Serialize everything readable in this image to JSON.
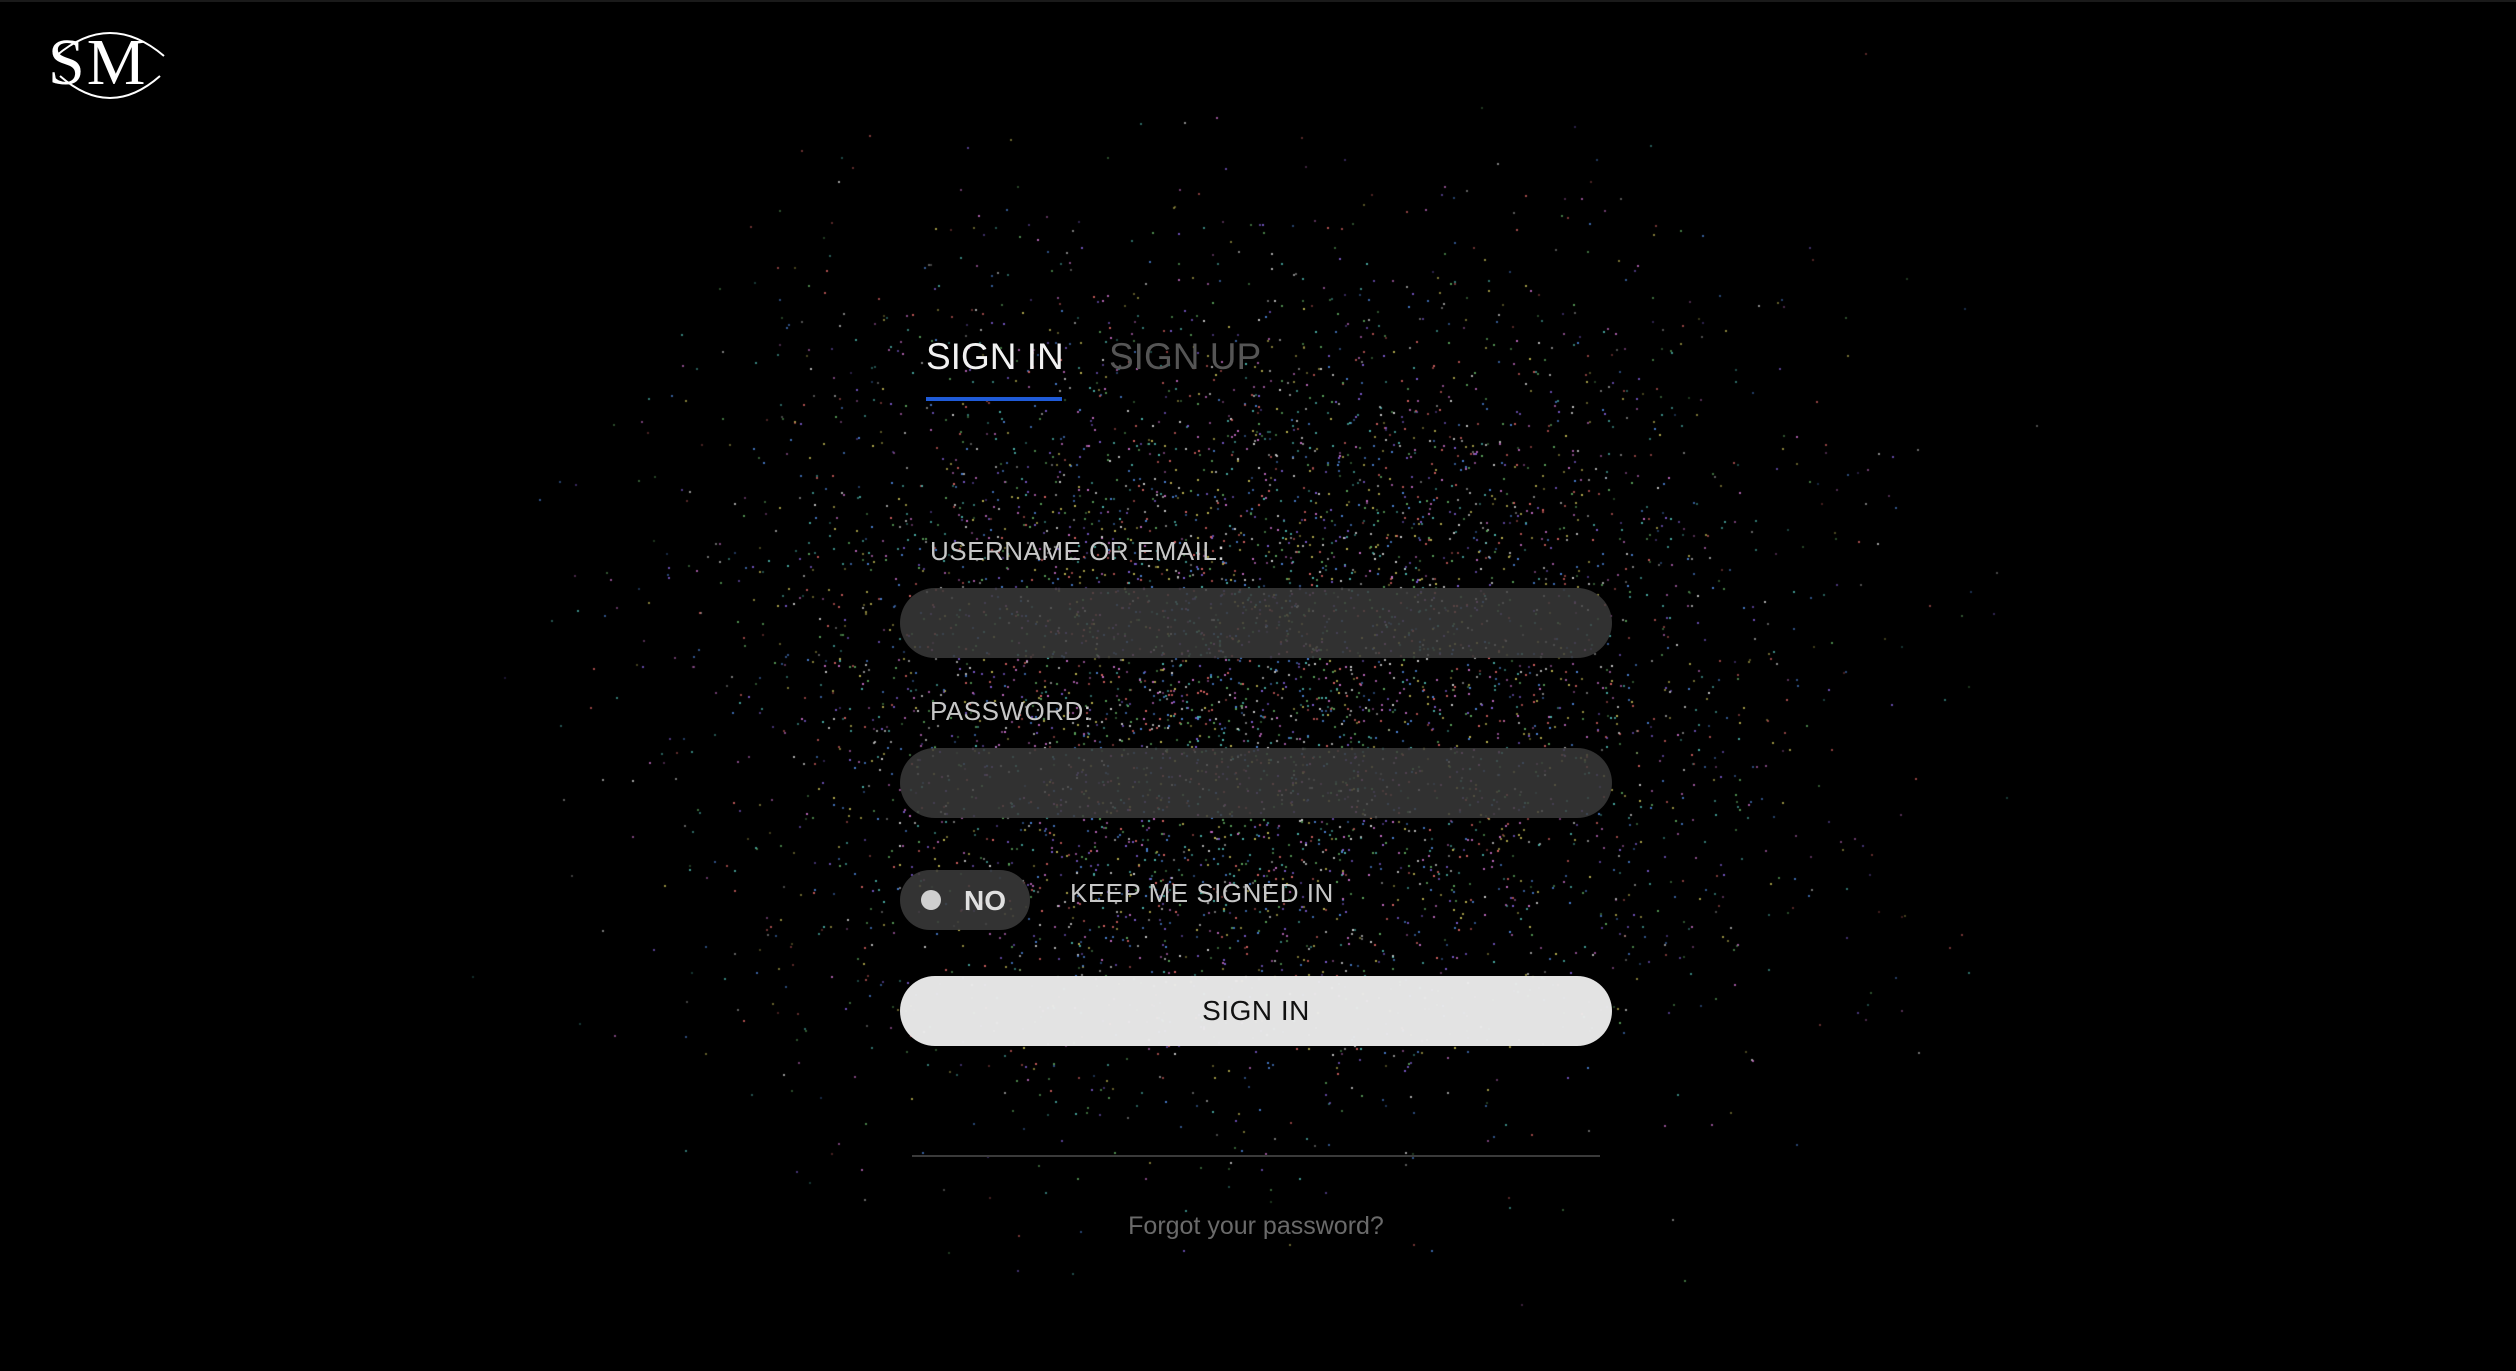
{
  "brand": {
    "logo_text": "SM"
  },
  "tabs": [
    {
      "label": "SIGN IN",
      "active": true
    },
    {
      "label": "SIGN UP",
      "active": false
    }
  ],
  "form": {
    "username_label": "USERNAME OR EMAIL:",
    "username_value": "",
    "password_label": "PASSWORD:",
    "password_value": "",
    "keep_signed_in": {
      "toggle_state": "NO",
      "label": "KEEP ME SIGNED IN"
    },
    "submit_label": "SIGN IN",
    "forgot_link": "Forgot your password?"
  },
  "colors": {
    "background": "#000000",
    "accent": "#1f5bd8",
    "input_background": "#3c3c3c",
    "button_background": "#ececec"
  }
}
